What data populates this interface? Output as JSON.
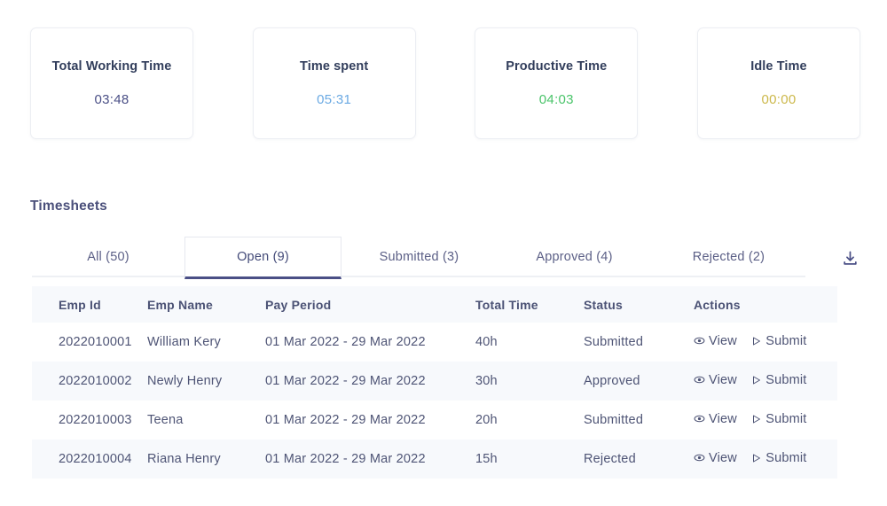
{
  "stat_cards": [
    {
      "title": "Total Working Time",
      "value": "03:48",
      "color": "#4a4f86"
    },
    {
      "title": "Time spent",
      "value": "05:31",
      "color": "#6aa9e3"
    },
    {
      "title": "Productive Time",
      "value": "04:03",
      "color": "#4ac46a"
    },
    {
      "title": "Idle Time",
      "value": "00:00",
      "color": "#ccb84a"
    }
  ],
  "section": {
    "title": "Timesheets"
  },
  "tabs": [
    {
      "label": "All (50)",
      "active": false
    },
    {
      "label": "Open (9)",
      "active": true
    },
    {
      "label": "Submitted (3)",
      "active": false
    },
    {
      "label": "Approved (4)",
      "active": false
    },
    {
      "label": "Rejected (2)",
      "active": false
    }
  ],
  "toolbar": {
    "download_icon": "download-icon"
  },
  "table": {
    "columns": [
      "Emp Id",
      "Emp Name",
      "Pay Period",
      "Total Time",
      "Status",
      "Actions"
    ],
    "actions": {
      "view_label": "View",
      "view_icon": "eye-icon",
      "submit_label": "Submit",
      "submit_icon": "send-icon"
    },
    "rows": [
      {
        "emp_id": "2022010001",
        "emp_name": "William Kery",
        "pay_period": "01 Mar 2022 - 29 Mar 2022",
        "total_time": "40h",
        "status": "Submitted"
      },
      {
        "emp_id": "2022010002",
        "emp_name": "Newly Henry",
        "pay_period": "01 Mar 2022 - 29 Mar 2022",
        "total_time": "30h",
        "status": "Approved"
      },
      {
        "emp_id": "2022010003",
        "emp_name": "Teena",
        "pay_period": "01 Mar 2022 - 29 Mar 2022",
        "total_time": "20h",
        "status": "Submitted"
      },
      {
        "emp_id": "2022010004",
        "emp_name": "Riana Henry",
        "pay_period": "01 Mar 2022 - 29 Mar 2022",
        "total_time": "15h",
        "status": "Rejected"
      }
    ]
  }
}
